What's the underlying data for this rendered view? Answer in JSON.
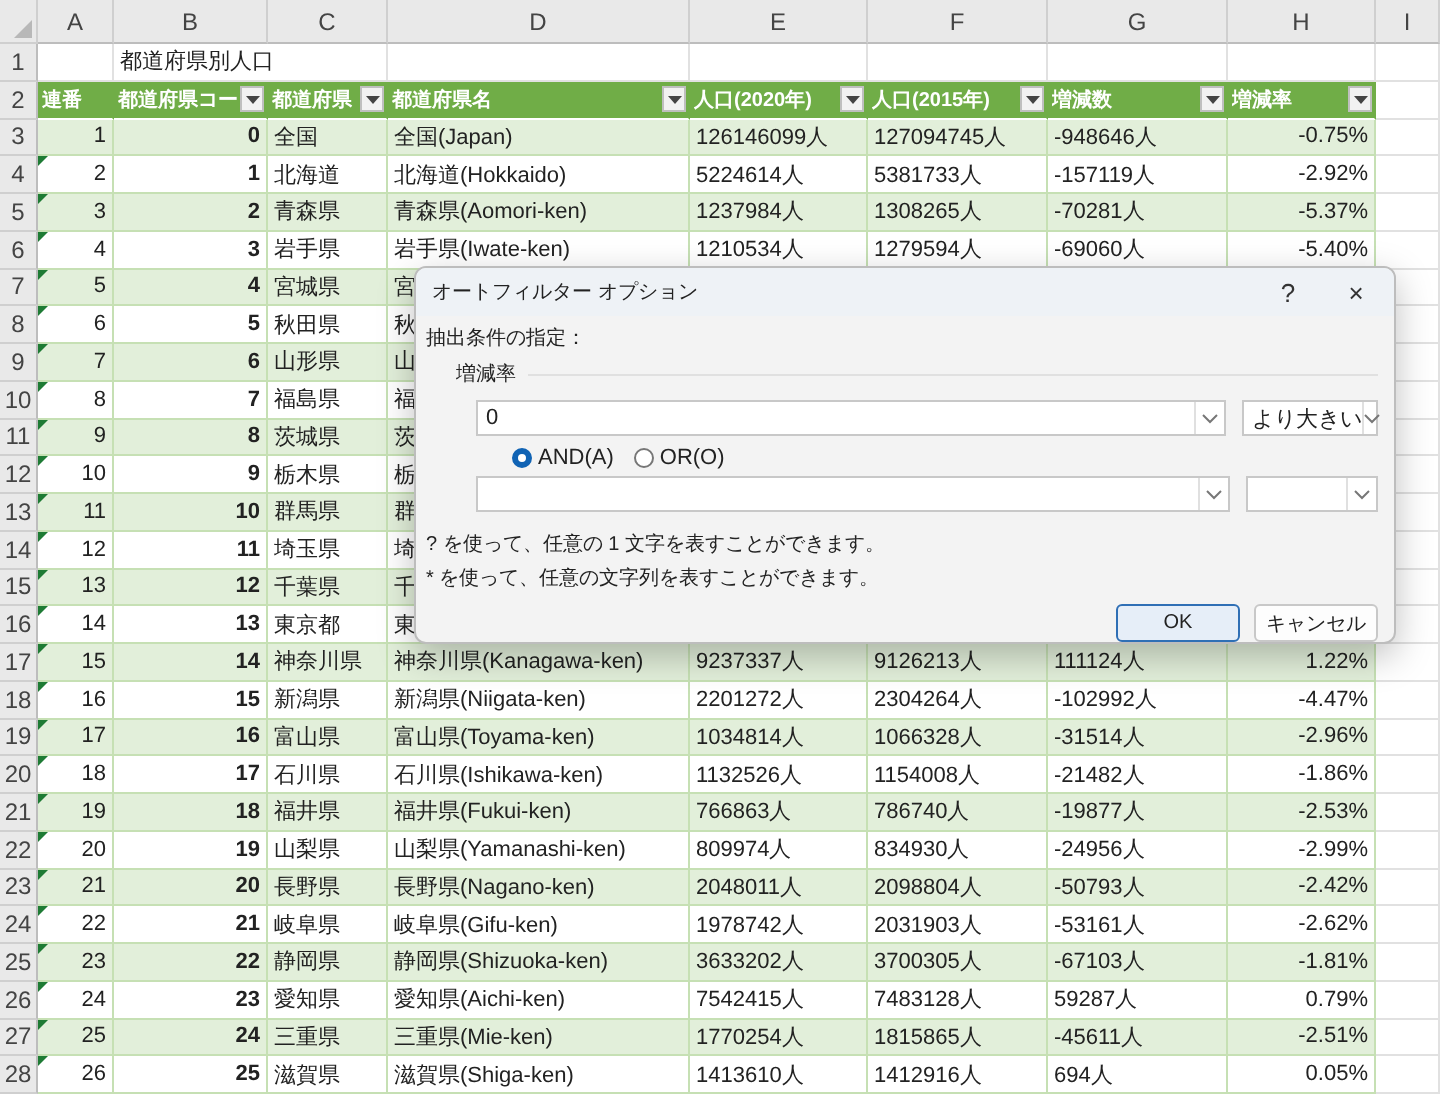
{
  "column_headers": [
    "A",
    "B",
    "C",
    "D",
    "E",
    "F",
    "G",
    "H",
    "I"
  ],
  "row_numbers": [
    "1",
    "2",
    "3",
    "4",
    "5",
    "6",
    "7",
    "8",
    "9",
    "10",
    "11",
    "12",
    "13",
    "14",
    "15",
    "16",
    "17",
    "18",
    "19",
    "20",
    "21",
    "22",
    "23",
    "24",
    "25",
    "26",
    "27",
    "28"
  ],
  "sheet_title": "都道府県別人口",
  "table": {
    "columns": [
      {
        "label": "連番",
        "filter": false
      },
      {
        "label": "都道府県コー",
        "filter": true
      },
      {
        "label": "都道府県",
        "filter": true
      },
      {
        "label": "都道府県名",
        "filter": true
      },
      {
        "label": "人口(2020年)",
        "filter": true
      },
      {
        "label": "人口(2015年)",
        "filter": true
      },
      {
        "label": "増減数",
        "filter": true
      },
      {
        "label": "増減率",
        "filter": true
      }
    ],
    "rows": [
      {
        "warning": false,
        "cells": [
          "1",
          "0",
          "全国",
          "全国(Japan)",
          "126146099人",
          "127094745人",
          "-948646人",
          "-0.75%"
        ]
      },
      {
        "warning": true,
        "cells": [
          "2",
          "1",
          "北海道",
          "北海道(Hokkaido)",
          "5224614人",
          "5381733人",
          "-157119人",
          "-2.92%"
        ]
      },
      {
        "warning": true,
        "cells": [
          "3",
          "2",
          "青森県",
          "青森県(Aomori-ken)",
          "1237984人",
          "1308265人",
          "-70281人",
          "-5.37%"
        ]
      },
      {
        "warning": true,
        "cells": [
          "4",
          "3",
          "岩手県",
          "岩手県(Iwate-ken)",
          "1210534人",
          "1279594人",
          "-69060人",
          "-5.40%"
        ]
      },
      {
        "warning": true,
        "cells": [
          "5",
          "4",
          "宮城県",
          "宮"
        ]
      },
      {
        "warning": true,
        "cells": [
          "6",
          "5",
          "秋田県",
          "秋"
        ]
      },
      {
        "warning": true,
        "cells": [
          "7",
          "6",
          "山形県",
          "山"
        ]
      },
      {
        "warning": true,
        "cells": [
          "8",
          "7",
          "福島県",
          "福"
        ]
      },
      {
        "warning": true,
        "cells": [
          "9",
          "8",
          "茨城県",
          "茨"
        ]
      },
      {
        "warning": true,
        "cells": [
          "10",
          "9",
          "栃木県",
          "栃"
        ]
      },
      {
        "warning": true,
        "cells": [
          "11",
          "10",
          "群馬県",
          "群"
        ]
      },
      {
        "warning": true,
        "cells": [
          "12",
          "11",
          "埼玉県",
          "埼"
        ]
      },
      {
        "warning": true,
        "cells": [
          "13",
          "12",
          "千葉県",
          "千"
        ]
      },
      {
        "warning": true,
        "cells": [
          "14",
          "13",
          "東京都",
          "東"
        ]
      },
      {
        "warning": true,
        "cells": [
          "15",
          "14",
          "神奈川県",
          "神奈川県(Kanagawa-ken)",
          "9237337人",
          "9126213人",
          "111124人",
          "1.22%"
        ]
      },
      {
        "warning": true,
        "cells": [
          "16",
          "15",
          "新潟県",
          "新潟県(Niigata-ken)",
          "2201272人",
          "2304264人",
          "-102992人",
          "-4.47%"
        ]
      },
      {
        "warning": true,
        "cells": [
          "17",
          "16",
          "富山県",
          "富山県(Toyama-ken)",
          "1034814人",
          "1066328人",
          "-31514人",
          "-2.96%"
        ]
      },
      {
        "warning": true,
        "cells": [
          "18",
          "17",
          "石川県",
          "石川県(Ishikawa-ken)",
          "1132526人",
          "1154008人",
          "-21482人",
          "-1.86%"
        ]
      },
      {
        "warning": true,
        "cells": [
          "19",
          "18",
          "福井県",
          "福井県(Fukui-ken)",
          "766863人",
          "786740人",
          "-19877人",
          "-2.53%"
        ]
      },
      {
        "warning": true,
        "cells": [
          "20",
          "19",
          "山梨県",
          "山梨県(Yamanashi-ken)",
          "809974人",
          "834930人",
          "-24956人",
          "-2.99%"
        ]
      },
      {
        "warning": true,
        "cells": [
          "21",
          "20",
          "長野県",
          "長野県(Nagano-ken)",
          "2048011人",
          "2098804人",
          "-50793人",
          "-2.42%"
        ]
      },
      {
        "warning": true,
        "cells": [
          "22",
          "21",
          "岐阜県",
          "岐阜県(Gifu-ken)",
          "1978742人",
          "2031903人",
          "-53161人",
          "-2.62%"
        ]
      },
      {
        "warning": true,
        "cells": [
          "23",
          "22",
          "静岡県",
          "静岡県(Shizuoka-ken)",
          "3633202人",
          "3700305人",
          "-67103人",
          "-1.81%"
        ]
      },
      {
        "warning": true,
        "cells": [
          "24",
          "23",
          "愛知県",
          "愛知県(Aichi-ken)",
          "7542415人",
          "7483128人",
          "59287人",
          "0.79%"
        ]
      },
      {
        "warning": true,
        "cells": [
          "25",
          "24",
          "三重県",
          "三重県(Mie-ken)",
          "1770254人",
          "1815865人",
          "-45611人",
          "-2.51%"
        ]
      },
      {
        "warning": true,
        "cells": [
          "26",
          "25",
          "滋賀県",
          "滋賀県(Shiga-ken)",
          "1413610人",
          "1412916人",
          "694人",
          "0.05%"
        ]
      }
    ]
  },
  "dialog": {
    "title": "オートフィルター オプション",
    "help": "?",
    "close": "×",
    "criteria_label": "抽出条件の指定：",
    "field_name": "増減率",
    "conditions": [
      {
        "value": "0",
        "operator": "より大きい"
      }
    ],
    "logic": [
      {
        "label": "AND(A)",
        "selected": true
      },
      {
        "label": "OR(O)",
        "selected": false
      }
    ],
    "hints": [
      "? を使って、任意の 1 文字を表すことができます。",
      "* を使って、任意の文字列を表すことができます。"
    ],
    "buttons": [
      {
        "label": "OK",
        "default": true
      },
      {
        "label": "キャンセル",
        "default": false
      }
    ]
  }
}
